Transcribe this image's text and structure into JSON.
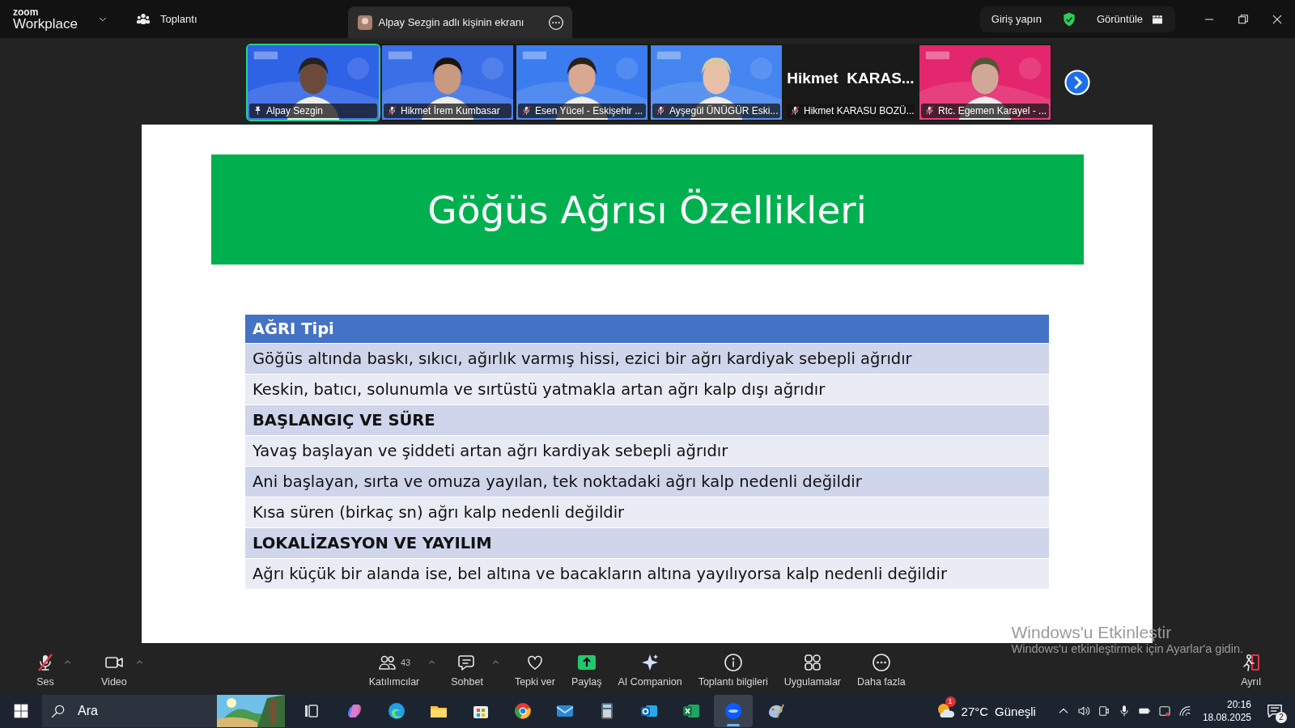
{
  "title_bar": {
    "logo_top": "zoom",
    "logo_bottom": "Workplace",
    "meeting": "Toplantı",
    "share_tab": "Alpay Sezgin adlı kişinin ekranı",
    "sign_in": "Giriş yapın",
    "view": "Görüntüle"
  },
  "participants": [
    {
      "name": "Alpay Sezgin",
      "kind": "video",
      "color": "#2f63e6",
      "muted": false,
      "selected": true
    },
    {
      "name": "Hikmet İrem Kumbasar",
      "kind": "video",
      "color": "#3a6fe8",
      "muted": true,
      "selected": false
    },
    {
      "name": "Esen Yücel - Eskişehir ...",
      "kind": "video",
      "color": "#3b7df0",
      "muted": true,
      "selected": false
    },
    {
      "name": "Ayşegül ÜNÜGÜR Eski...",
      "kind": "video",
      "color": "#4585f0",
      "muted": true,
      "selected": false
    },
    {
      "name": "Hikmet KARASU BOZÜ...",
      "kind": "name",
      "tile_text": "Hikmet  KARAS...",
      "muted": true,
      "selected": false
    },
    {
      "name": "Rtc. Egemen Karayel - ...",
      "kind": "video",
      "color": "#e4266e",
      "muted": true,
      "selected": false
    }
  ],
  "slide": {
    "title": "Göğüs Ağrısı Özellikleri",
    "rows": [
      {
        "kind": "header",
        "text": "AĞRI Tipi"
      },
      {
        "kind": "row",
        "text": "Göğüs altında baskı, sıkıcı, ağırlık varmış hissi, ezici bir ağrı kardiyak sebepli ağrıdır"
      },
      {
        "kind": "row",
        "text": "Keskin, batıcı, solunumla ve sırtüstü yatmakla artan ağrı kalp dışı ağrıdır"
      },
      {
        "kind": "section",
        "text": "BAŞLANGIÇ VE SÜRE"
      },
      {
        "kind": "row",
        "text": "Yavaş başlayan ve şiddeti artan ağrı kardiyak sebepli ağrıdır"
      },
      {
        "kind": "row",
        "text": "Ani başlayan, sırta ve omuza yayılan, tek noktadaki ağrı kalp nedenli değildir"
      },
      {
        "kind": "row",
        "text": "Kısa süren (birkaç sn) ağrı kalp nedenli değildir"
      },
      {
        "kind": "section",
        "text": "LOKALİZASYON VE YAYILIM"
      },
      {
        "kind": "row",
        "text": "Ağrı küçük bir alanda ise, bel altına ve bacakların altına yayılıyorsa kalp nedenli değildir"
      }
    ]
  },
  "activation_notice": {
    "title": "Windows'u Etkinleştir",
    "text": "Windows'u etkinleştirmek için Ayarlar'a gidin."
  },
  "toolbar": [
    {
      "kind": "mic",
      "label": "Ses",
      "muted": true,
      "caret": true
    },
    {
      "kind": "video",
      "label": "Video",
      "caret": true
    },
    {
      "kind": "participants",
      "label": "Katılımcılar",
      "count": "43",
      "caret": true
    },
    {
      "kind": "chat",
      "label": "Sohbet",
      "caret": true
    },
    {
      "kind": "react",
      "label": "Tepki ver",
      "caret": false
    },
    {
      "kind": "share",
      "label": "Paylaş",
      "caret": false
    },
    {
      "kind": "ai",
      "label": "AI Companion",
      "caret": false
    },
    {
      "kind": "info",
      "label": "Toplantı bilgileri",
      "caret": false
    },
    {
      "kind": "apps",
      "label": "Uygulamalar",
      "caret": false
    },
    {
      "kind": "more",
      "label": "Daha fazla",
      "caret": false
    },
    {
      "kind": "leave",
      "label": "Ayrıl",
      "caret": false
    }
  ],
  "taskbar": {
    "search_placeholder": "Ara",
    "apps": [
      {
        "kind": "taskview",
        "selected": false
      },
      {
        "kind": "copilot",
        "selected": false
      },
      {
        "kind": "edge",
        "selected": false
      },
      {
        "kind": "folder",
        "selected": false
      },
      {
        "kind": "store",
        "selected": false
      },
      {
        "kind": "chrome",
        "selected": false
      },
      {
        "kind": "mail",
        "selected": false
      },
      {
        "kind": "calc",
        "selected": false
      },
      {
        "kind": "outlook",
        "selected": false
      },
      {
        "kind": "excel",
        "selected": false
      },
      {
        "kind": "zoom",
        "selected": true
      },
      {
        "kind": "paint",
        "selected": false
      }
    ],
    "weather_badge": "1",
    "temperature": "27°C",
    "weather": "Güneşli",
    "time": "20:16",
    "date": "18.08.2025",
    "notifications": "2"
  }
}
